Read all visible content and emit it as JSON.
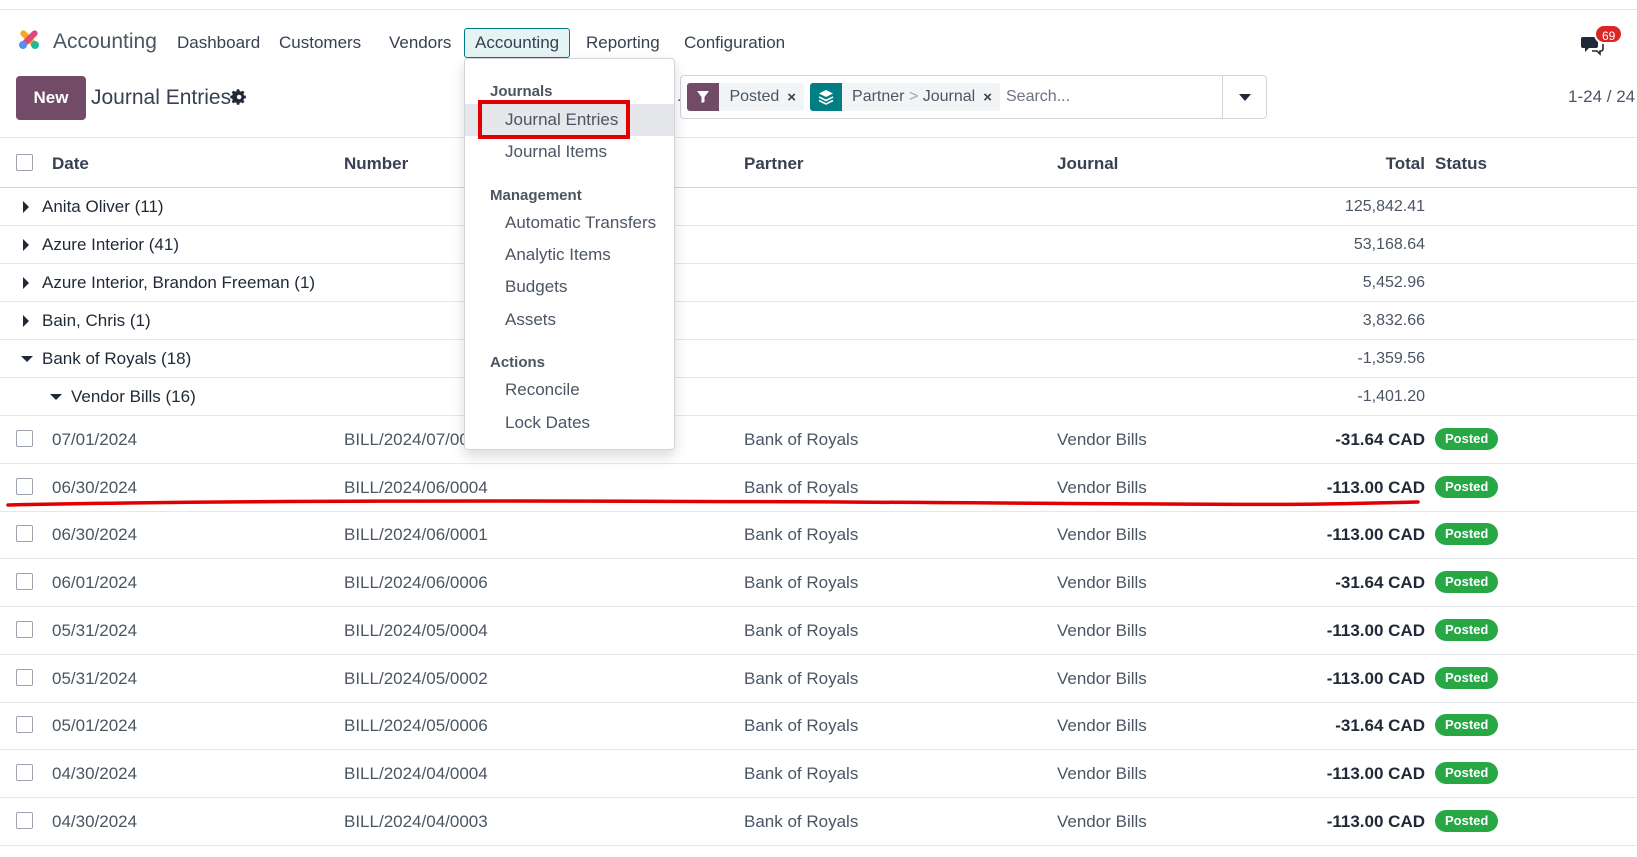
{
  "navbar": {
    "app_name": "Accounting",
    "items": [
      "Dashboard",
      "Customers",
      "Vendors",
      "Accounting",
      "Reporting",
      "Configuration"
    ],
    "active": "Accounting",
    "notifications": "69"
  },
  "control": {
    "new_label": "New",
    "title": "Journal Entries",
    "facets": [
      {
        "icon": "filter-icon",
        "label": "Posted"
      },
      {
        "icon": "layers-icon",
        "label_a": "Partner",
        "sep": ">",
        "label_b": "Journal"
      }
    ],
    "search_placeholder": "Search...",
    "pager": "1-24 / 24"
  },
  "table": {
    "headers": {
      "date": "Date",
      "number": "Number",
      "partner": "Partner",
      "journal": "Journal",
      "total": "Total",
      "status": "Status"
    },
    "groups": [
      {
        "label": "Anita Oliver (11)",
        "total": "125,842.41"
      },
      {
        "label": "Azure Interior (41)",
        "total": "53,168.64"
      },
      {
        "label": "Azure Interior, Brandon Freeman (1)",
        "total": "5,452.96"
      },
      {
        "label": "Bain, Chris (1)",
        "total": "3,832.66"
      },
      {
        "label": "Bank of Royals (18)",
        "total": "-1,359.56"
      },
      {
        "label": "Vendor Bills (16)",
        "total": "-1,401.20"
      }
    ],
    "rows": [
      {
        "date": "07/01/2024",
        "number": "BILL/2024/07/00",
        "partner": "Bank of Royals",
        "journal": "Vendor Bills",
        "total": "-31.64 CAD",
        "status": "Posted"
      },
      {
        "date": "06/30/2024",
        "number": "BILL/2024/06/0004",
        "partner": "Bank of Royals",
        "journal": "Vendor Bills",
        "total": "-113.00 CAD",
        "status": "Posted"
      },
      {
        "date": "06/30/2024",
        "number": "BILL/2024/06/0001",
        "partner": "Bank of Royals",
        "journal": "Vendor Bills",
        "total": "-113.00 CAD",
        "status": "Posted"
      },
      {
        "date": "06/01/2024",
        "number": "BILL/2024/06/0006",
        "partner": "Bank of Royals",
        "journal": "Vendor Bills",
        "total": "-31.64 CAD",
        "status": "Posted"
      },
      {
        "date": "05/31/2024",
        "number": "BILL/2024/05/0004",
        "partner": "Bank of Royals",
        "journal": "Vendor Bills",
        "total": "-113.00 CAD",
        "status": "Posted"
      },
      {
        "date": "05/31/2024",
        "number": "BILL/2024/05/0002",
        "partner": "Bank of Royals",
        "journal": "Vendor Bills",
        "total": "-113.00 CAD",
        "status": "Posted"
      },
      {
        "date": "05/01/2024",
        "number": "BILL/2024/05/0006",
        "partner": "Bank of Royals",
        "journal": "Vendor Bills",
        "total": "-31.64 CAD",
        "status": "Posted"
      },
      {
        "date": "04/30/2024",
        "number": "BILL/2024/04/0004",
        "partner": "Bank of Royals",
        "journal": "Vendor Bills",
        "total": "-113.00 CAD",
        "status": "Posted"
      },
      {
        "date": "04/30/2024",
        "number": "BILL/2024/04/0003",
        "partner": "Bank of Royals",
        "journal": "Vendor Bills",
        "total": "-113.00 CAD",
        "status": "Posted"
      }
    ]
  },
  "menu": {
    "sections": [
      {
        "heading": "Journals",
        "items": [
          "Journal Entries",
          "Journal Items"
        ]
      },
      {
        "heading": "Management",
        "items": [
          "Automatic Transfers",
          "Analytic Items",
          "Budgets",
          "Assets"
        ]
      },
      {
        "heading": "Actions",
        "items": [
          "Reconcile",
          "Lock Dates"
        ]
      }
    ]
  },
  "colors": {
    "brand": "#714b67",
    "accent": "#017e84",
    "posted": "#28a745",
    "annotation": "#e00000"
  }
}
